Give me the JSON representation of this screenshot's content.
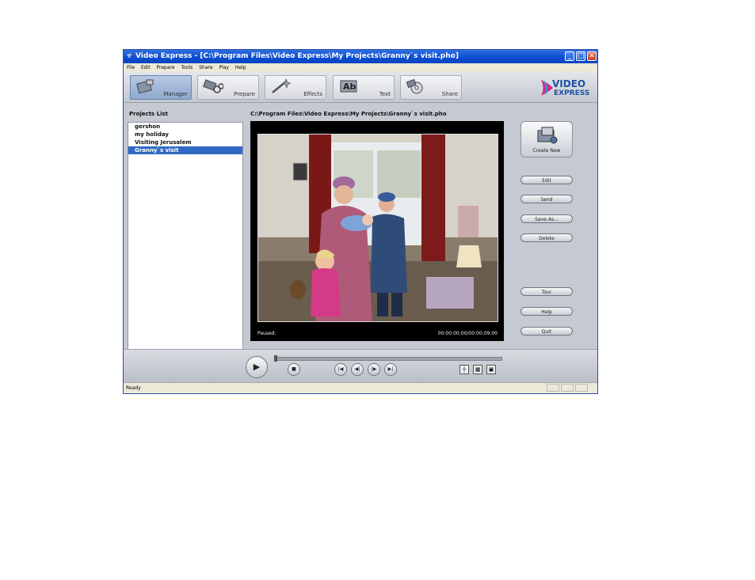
{
  "window": {
    "title": "Video Express - [C:\\Program Files\\Video Express\\My Projects\\Granny`s visit.pho]",
    "minimize": "_",
    "maximize": "□",
    "close": "✕"
  },
  "menu": [
    "File",
    "Edit",
    "Prepare",
    "Tools",
    "Share",
    "Play",
    "Help"
  ],
  "toolbar": {
    "tabs": [
      {
        "label": "Manager",
        "icon": "manager-icon",
        "active": true
      },
      {
        "label": "Prepare",
        "icon": "prepare-icon",
        "active": false
      },
      {
        "label": "Effects",
        "icon": "effects-icon",
        "active": false
      },
      {
        "label": "Text",
        "icon": "text-icon",
        "active": false
      },
      {
        "label": "Share",
        "icon": "share-icon",
        "active": false
      }
    ],
    "logo": {
      "line1": "VIDEO",
      "line2": "EXPRESS"
    }
  },
  "projects": {
    "title": "Projects List",
    "items": [
      "gershon",
      "my holiday",
      "Visiting Jerusalem",
      "Granny`s visit"
    ],
    "selected_index": 3
  },
  "viewer": {
    "path": "C:\\Program Files\\Video Express\\My Projects\\Granny`s visit.pho",
    "status": "Paused:",
    "timecode": "00:00:00:00/00:00:09:00"
  },
  "actions": {
    "create_new": "Create New",
    "edit": "Edit",
    "send": "Send",
    "save_as": "Save As...",
    "delete": "Delete",
    "tour": "Tour",
    "help": "Help",
    "quit": "Quit"
  },
  "statusbar": {
    "text": "Ready"
  },
  "colors": {
    "title_bar": "#0b4ccf",
    "selection": "#316ac5",
    "active_tab": "#8ea9cf"
  }
}
